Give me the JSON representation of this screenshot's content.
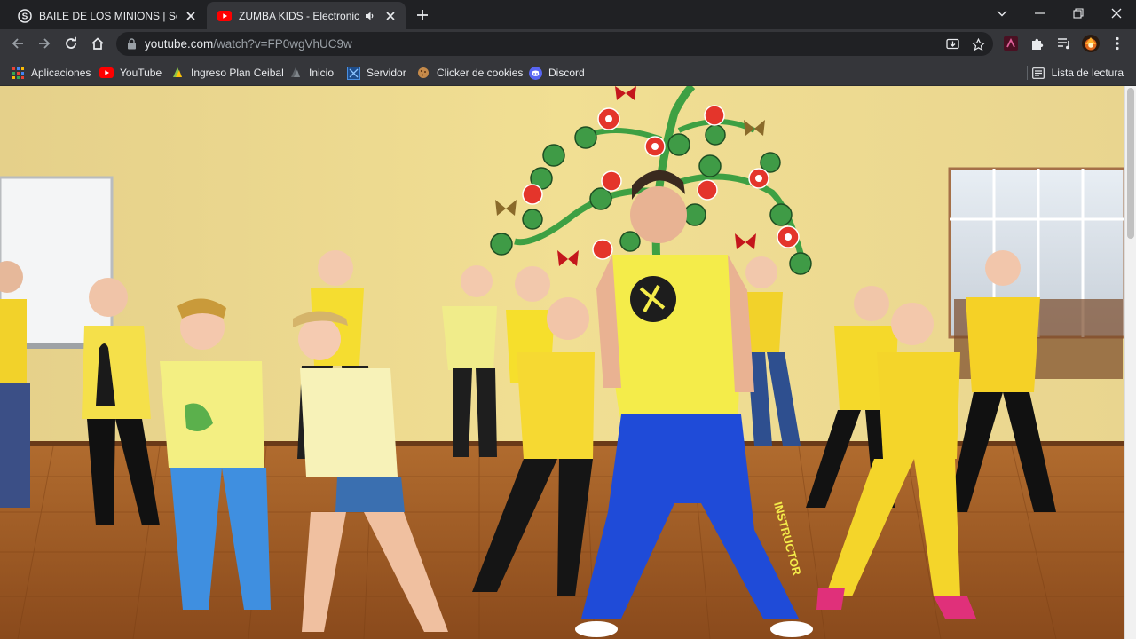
{
  "tabs": [
    {
      "title": "BAILE DE LOS MINIONS | Schoolo",
      "favicon": "schoology-icon",
      "active": false
    },
    {
      "title": "ZUMBA KIDS - Electronic Son",
      "favicon": "youtube-icon",
      "active": true,
      "audio": true
    }
  ],
  "url": {
    "host": "youtube.com",
    "path": "/watch?v=FP0wgVhUC9w"
  },
  "bookmarks": [
    {
      "label": "Aplicaciones",
      "icon": "apps-grid-icon"
    },
    {
      "label": "YouTube",
      "icon": "youtube-icon"
    },
    {
      "label": "Ingreso Plan Ceibal",
      "icon": "ceibal-icon"
    },
    {
      "label": "Inicio",
      "icon": "ceibal-icon"
    },
    {
      "label": "Servidor",
      "icon": "server-icon"
    },
    {
      "label": "Clicker de cookies",
      "icon": "cookie-icon"
    },
    {
      "label": "Discord",
      "icon": "discord-icon"
    }
  ],
  "reading_list": {
    "label": "Lista de lectura",
    "icon": "reading-list-icon"
  },
  "video": {
    "shirt_text": "INSTRUCTOR",
    "scene": "zumba-kids-dance-studio"
  },
  "colors": {
    "tab_strip": "#202124",
    "toolbar": "#35363a",
    "youtube_red": "#ff0000",
    "discord": "#5865f2"
  }
}
